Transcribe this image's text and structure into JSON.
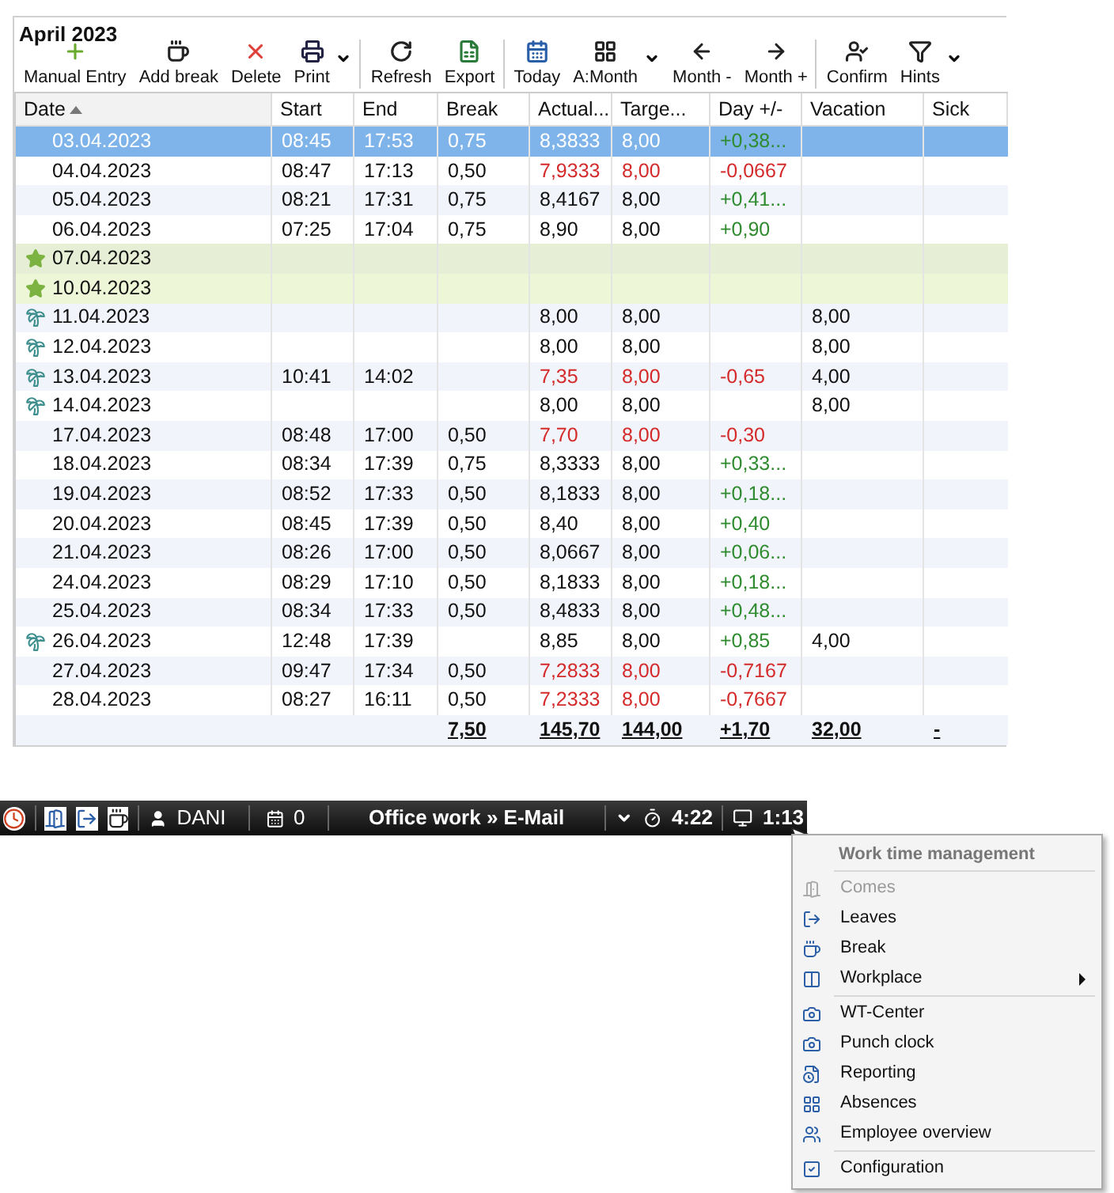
{
  "title": "April 2023",
  "toolbar": [
    {
      "label": "Manual Entry",
      "dropdown": false,
      "group_end": false
    },
    {
      "label": "Add break",
      "dropdown": false,
      "group_end": false
    },
    {
      "label": "Delete",
      "dropdown": false,
      "group_end": false
    },
    {
      "label": "Print",
      "dropdown": true,
      "group_end": true
    },
    {
      "label": "Refresh",
      "dropdown": false,
      "group_end": false
    },
    {
      "label": "Export",
      "dropdown": false,
      "group_end": true
    },
    {
      "label": "Today",
      "dropdown": false,
      "group_end": false
    },
    {
      "label": "A:Month",
      "dropdown": true,
      "group_end": false
    },
    {
      "label": "Month -",
      "dropdown": false,
      "group_end": false
    },
    {
      "label": "Month +",
      "dropdown": false,
      "group_end": true
    },
    {
      "label": "Confirm",
      "dropdown": false,
      "group_end": false
    },
    {
      "label": "Hints",
      "dropdown": true,
      "group_end": false
    }
  ],
  "table": {
    "columns": [
      {
        "label": "Date",
        "sorted": true
      },
      {
        "label": "Start",
        "sorted": false
      },
      {
        "label": "End",
        "sorted": false
      },
      {
        "label": "Break",
        "sorted": false
      },
      {
        "label": "Actual...",
        "sorted": false
      },
      {
        "label": "Targe...",
        "sorted": false
      },
      {
        "label": "Day +/-",
        "sorted": false
      },
      {
        "label": "Vacation",
        "sorted": false
      },
      {
        "label": "Sick",
        "sorted": false
      }
    ],
    "rows": [
      {
        "kind": "work",
        "selected": true,
        "deficit": false,
        "date": "03.04.2023",
        "start": "08:45",
        "end": "17:53",
        "break": "0,75",
        "actual": "8,3833",
        "target": "8,00",
        "day": "+0,38...",
        "vacation": ""
      },
      {
        "kind": "work",
        "selected": false,
        "deficit": true,
        "date": "04.04.2023",
        "start": "08:47",
        "end": "17:13",
        "break": "0,50",
        "actual": "7,9333",
        "target": "8,00",
        "day": "-0,0667",
        "vacation": ""
      },
      {
        "kind": "work",
        "selected": false,
        "deficit": false,
        "date": "05.04.2023",
        "start": "08:21",
        "end": "17:31",
        "break": "0,75",
        "actual": "8,4167",
        "target": "8,00",
        "day": "+0,41...",
        "vacation": ""
      },
      {
        "kind": "work",
        "selected": false,
        "deficit": false,
        "date": "06.04.2023",
        "start": "07:25",
        "end": "17:04",
        "break": "0,75",
        "actual": "8,90",
        "target": "8,00",
        "day": "+0,90",
        "vacation": ""
      },
      {
        "kind": "holiday",
        "selected": false,
        "date": "07.04.2023",
        "start": "",
        "end": "",
        "break": "",
        "actual": "",
        "target": "",
        "day": "",
        "vacation": ""
      },
      {
        "kind": "holiday",
        "selected": false,
        "date": "10.04.2023",
        "start": "",
        "end": "",
        "break": "",
        "actual": "",
        "target": "",
        "day": "",
        "vacation": ""
      },
      {
        "kind": "vacation",
        "selected": false,
        "deficit": false,
        "date": "11.04.2023",
        "start": "",
        "end": "",
        "break": "",
        "actual": "8,00",
        "target": "8,00",
        "day": "",
        "vacation": "8,00"
      },
      {
        "kind": "vacation",
        "selected": false,
        "deficit": false,
        "date": "12.04.2023",
        "start": "",
        "end": "",
        "break": "",
        "actual": "8,00",
        "target": "8,00",
        "day": "",
        "vacation": "8,00"
      },
      {
        "kind": "vacation",
        "selected": false,
        "deficit": true,
        "date": "13.04.2023",
        "start": "10:41",
        "end": "14:02",
        "break": "",
        "actual": "7,35",
        "target": "8,00",
        "day": "-0,65",
        "vacation": "4,00"
      },
      {
        "kind": "vacation",
        "selected": false,
        "deficit": false,
        "date": "14.04.2023",
        "start": "",
        "end": "",
        "break": "",
        "actual": "8,00",
        "target": "8,00",
        "day": "",
        "vacation": "8,00"
      },
      {
        "kind": "work",
        "selected": false,
        "deficit": true,
        "date": "17.04.2023",
        "start": "08:48",
        "end": "17:00",
        "break": "0,50",
        "actual": "7,70",
        "target": "8,00",
        "day": "-0,30",
        "vacation": ""
      },
      {
        "kind": "work",
        "selected": false,
        "deficit": false,
        "date": "18.04.2023",
        "start": "08:34",
        "end": "17:39",
        "break": "0,75",
        "actual": "8,3333",
        "target": "8,00",
        "day": "+0,33...",
        "vacation": ""
      },
      {
        "kind": "work",
        "selected": false,
        "deficit": false,
        "date": "19.04.2023",
        "start": "08:52",
        "end": "17:33",
        "break": "0,50",
        "actual": "8,1833",
        "target": "8,00",
        "day": "+0,18...",
        "vacation": ""
      },
      {
        "kind": "work",
        "selected": false,
        "deficit": false,
        "date": "20.04.2023",
        "start": "08:45",
        "end": "17:39",
        "break": "0,50",
        "actual": "8,40",
        "target": "8,00",
        "day": "+0,40",
        "vacation": ""
      },
      {
        "kind": "work",
        "selected": false,
        "deficit": false,
        "date": "21.04.2023",
        "start": "08:26",
        "end": "17:00",
        "break": "0,50",
        "actual": "8,0667",
        "target": "8,00",
        "day": "+0,06...",
        "vacation": ""
      },
      {
        "kind": "work",
        "selected": false,
        "deficit": false,
        "date": "24.04.2023",
        "start": "08:29",
        "end": "17:10",
        "break": "0,50",
        "actual": "8,1833",
        "target": "8,00",
        "day": "+0,18...",
        "vacation": ""
      },
      {
        "kind": "work",
        "selected": false,
        "deficit": false,
        "date": "25.04.2023",
        "start": "08:34",
        "end": "17:33",
        "break": "0,50",
        "actual": "8,4833",
        "target": "8,00",
        "day": "+0,48...",
        "vacation": ""
      },
      {
        "kind": "vacation",
        "selected": false,
        "deficit": false,
        "date": "26.04.2023",
        "start": "12:48",
        "end": "17:39",
        "break": "",
        "actual": "8,85",
        "target": "8,00",
        "day": "+0,85",
        "vacation": "4,00"
      },
      {
        "kind": "work",
        "selected": false,
        "deficit": true,
        "date": "27.04.2023",
        "start": "09:47",
        "end": "17:34",
        "break": "0,50",
        "actual": "7,2833",
        "target": "8,00",
        "day": "-0,7167",
        "vacation": ""
      },
      {
        "kind": "work",
        "selected": false,
        "deficit": true,
        "date": "28.04.2023",
        "start": "08:27",
        "end": "16:11",
        "break": "0,50",
        "actual": "7,2333",
        "target": "8,00",
        "day": "-0,7667",
        "vacation": ""
      }
    ],
    "totals": {
      "break": "7,50",
      "actual": "145,70",
      "target": "144,00",
      "day": "+1,70",
      "vacation": "32,00",
      "sick": "-"
    }
  },
  "taskbar": {
    "user": "DANI",
    "count": "0",
    "activity": "Office work » E-Mail",
    "timer": "4:22",
    "session": "1:13"
  },
  "menu": {
    "title": "Work time management",
    "groups": [
      [
        {
          "label": "Comes",
          "disabled": true,
          "submenu": false
        },
        {
          "label": "Leaves",
          "disabled": false,
          "submenu": false
        },
        {
          "label": "Break",
          "disabled": false,
          "submenu": false
        },
        {
          "label": "Workplace",
          "disabled": false,
          "submenu": true
        }
      ],
      [
        {
          "label": "WT-Center",
          "disabled": false,
          "submenu": false
        },
        {
          "label": "Punch clock",
          "disabled": false,
          "submenu": false
        },
        {
          "label": "Reporting",
          "disabled": false,
          "submenu": false
        },
        {
          "label": "Absences",
          "disabled": false,
          "submenu": false
        },
        {
          "label": "Employee overview",
          "disabled": false,
          "submenu": false
        }
      ],
      [
        {
          "label": "Configuration",
          "disabled": false,
          "submenu": false
        }
      ]
    ]
  }
}
